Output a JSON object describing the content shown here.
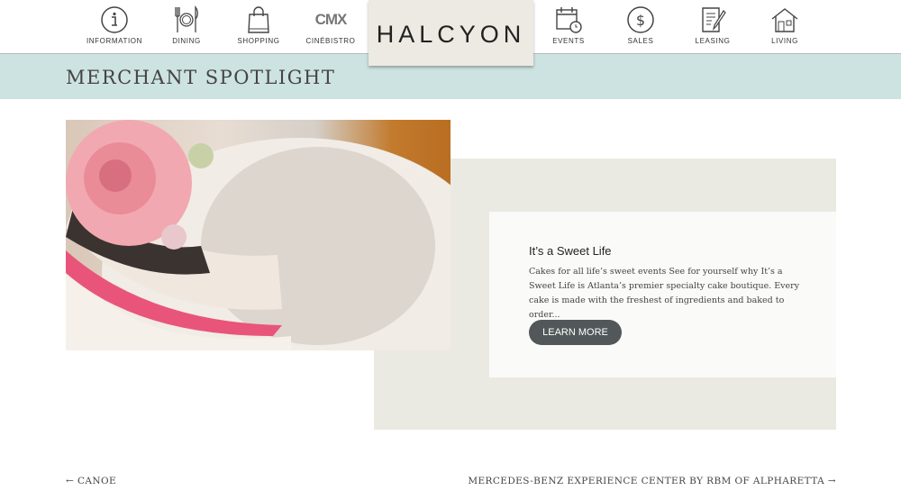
{
  "nav": {
    "items": [
      {
        "label": "INFORMATION",
        "icon": "info-icon"
      },
      {
        "label": "DINING",
        "icon": "dining-icon"
      },
      {
        "label": "SHOPPING",
        "icon": "shopping-bag-icon"
      },
      {
        "label": "CINÉBISTRO",
        "icon": "cmx-logo",
        "logo_text": "CMX"
      },
      {
        "label": "EVENTS",
        "icon": "calendar-icon"
      },
      {
        "label": "SALES",
        "icon": "dollar-icon"
      },
      {
        "label": "LEASING",
        "icon": "document-icon"
      },
      {
        "label": "LIVING",
        "icon": "house-icon"
      }
    ],
    "brand": "HALCYON"
  },
  "section_title": "MERCHANT SPOTLIGHT",
  "spotlight": {
    "title": "It’s a Sweet Life",
    "description": "Cakes for all life’s sweet events See for yourself why It’s a Sweet Life is Atlanta’s premier specialty cake boutique. Every cake is made with the freshest of ingredients and baked to order...",
    "button": "LEARN MORE"
  },
  "pagination": {
    "prev": "CANOE",
    "next": "MERCEDES-BENZ EXPERIENCE CENTER BY RBM OF ALPHARETTA"
  },
  "colors": {
    "band": "#cde3e1",
    "brand_box": "#eceae3",
    "button": "#525859"
  }
}
